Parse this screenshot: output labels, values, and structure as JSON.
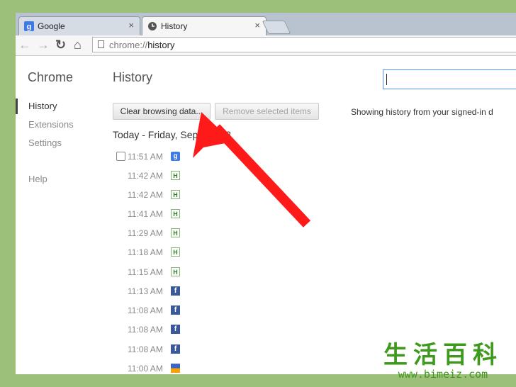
{
  "tabs": [
    {
      "label": "Google",
      "icon": "google-favicon",
      "active": false
    },
    {
      "label": "History",
      "icon": "clock-icon",
      "active": true
    }
  ],
  "toolbar": {
    "url_scheme": "chrome://",
    "url_path": "history"
  },
  "sidebar": {
    "title": "Chrome",
    "items": [
      {
        "label": "History",
        "selected": true
      },
      {
        "label": "Extensions",
        "selected": false
      },
      {
        "label": "Settings",
        "selected": false
      },
      {
        "label": "Help",
        "selected": false
      }
    ]
  },
  "main": {
    "title": "History",
    "search_value": "",
    "clear_button": "Clear browsing data...",
    "remove_button": "Remove selected items",
    "sync_note": "Showing history from your signed-in d",
    "day_heading": "Today - Friday, Septe          2013",
    "entries": [
      {
        "time": "11:51 AM",
        "icon": "google-favicon"
      },
      {
        "time": "11:42 AM",
        "icon": "h-favicon"
      },
      {
        "time": "11:42 AM",
        "icon": "h-favicon"
      },
      {
        "time": "11:41 AM",
        "icon": "h-favicon"
      },
      {
        "time": "11:29 AM",
        "icon": "h-favicon"
      },
      {
        "time": "11:18 AM",
        "icon": "h-favicon"
      },
      {
        "time": "11:15 AM",
        "icon": "h-favicon"
      },
      {
        "time": "11:13 AM",
        "icon": "facebook-favicon"
      },
      {
        "time": "11:08 AM",
        "icon": "facebook-favicon"
      },
      {
        "time": "11:08 AM",
        "icon": "facebook-favicon"
      },
      {
        "time": "11:08 AM",
        "icon": "facebook-favicon"
      },
      {
        "time": "11:00 AM",
        "icon": "bars-favicon"
      }
    ]
  },
  "watermark": {
    "chinese": "生活百科",
    "site": "www.bimeiz.com"
  },
  "colors": {
    "annotation_arrow": "#ff1a1a",
    "search_focus": "#4d90fe",
    "background": "#9cc07a"
  }
}
